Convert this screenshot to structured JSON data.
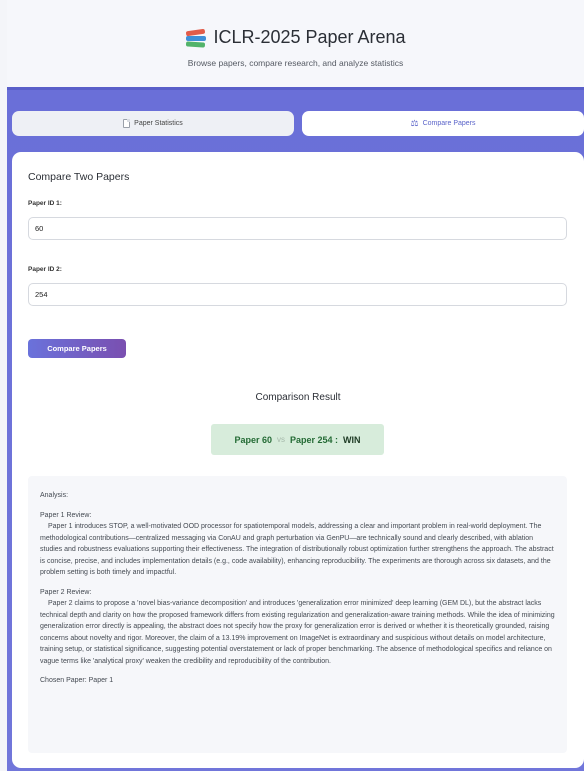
{
  "header": {
    "title": "ICLR-2025 Paper Arena",
    "subtitle": "Browse papers, compare research, and analyze statistics"
  },
  "tabs": [
    {
      "label": "Paper Statistics",
      "icon": "document-icon",
      "active": false
    },
    {
      "label": "Compare Papers",
      "icon": "scale-icon",
      "active": true
    }
  ],
  "compare": {
    "title": "Compare Two Papers",
    "paper1_label": "Paper ID 1:",
    "paper1_value": "60",
    "paper2_label": "Paper ID 2:",
    "paper2_value": "254",
    "button_label": "Compare Papers"
  },
  "result": {
    "title": "Comparison Result",
    "paper_a": "Paper 60",
    "vs": "vs",
    "paper_b": "Paper 254 :",
    "outcome": "WIN"
  },
  "analysis": {
    "heading": "Analysis:",
    "review1_heading": "Paper 1 Review:",
    "review1_body": "Paper 1 introduces STOP, a well-motivated OOD processor for spatiotemporal models, addressing a clear and important problem in real-world deployment. The methodological contributions—centralized messaging via ConAU and graph perturbation via GenPU—are technically sound and clearly described, with ablation studies and robustness evaluations supporting their effectiveness. The integration of distributionally robust optimization further strengthens the approach. The abstract is concise, precise, and includes implementation details (e.g., code availability), enhancing reproducibility. The experiments are thorough across six datasets, and the problem setting is both timely and impactful.",
    "review2_heading": "Paper 2 Review:",
    "review2_body": "Paper 2 claims to propose a 'novel bias-variance decomposition' and introduces 'generalization error minimized' deep learning (GEM DL), but the abstract lacks technical depth and clarity on how the proposed framework differs from existing regularization and generalization-aware training methods. While the idea of minimizing generalization error directly is appealing, the abstract does not specify how the proxy for generalization error is derived or whether it is theoretically grounded, raising concerns about novelty and rigor. Moreover, the claim of a 13.19% improvement on ImageNet is extraordinary and suspicious without details on model architecture, training setup, or statistical significance, suggesting potential overstatement or lack of proper benchmarking. The absence of methodological specifics and reliance on vague terms like 'analytical proxy' weaken the credibility and reproducibility of the contribution.",
    "chosen": "Chosen Paper: Paper 1"
  },
  "colors": {
    "accent": "#6a6fd8",
    "button_gradient_start": "#6a72db",
    "button_gradient_end": "#7a4fb0",
    "result_background": "#d7ecdb",
    "result_text": "#246b35"
  }
}
